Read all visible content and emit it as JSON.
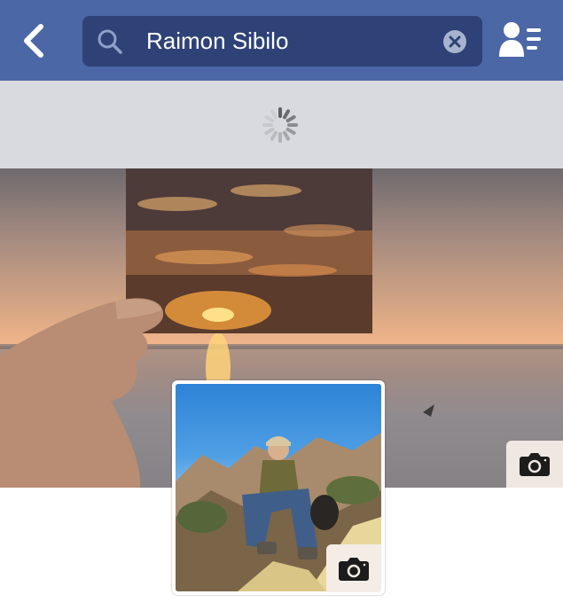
{
  "header": {
    "search_value": "Raimon Sibilo",
    "back_icon": "chevron-left-icon",
    "search_icon": "search-icon",
    "clear_icon": "clear-icon",
    "friends_icon": "friend-list-icon"
  },
  "loading": {
    "spinner_icon": "spinner-icon"
  },
  "cover": {
    "camera_icon": "camera-icon"
  },
  "profile": {
    "camera_icon": "camera-icon"
  },
  "colors": {
    "nav_bar": "#4b67a6",
    "search_bg": "#2f4277",
    "loading_bg": "#d8dae0"
  }
}
